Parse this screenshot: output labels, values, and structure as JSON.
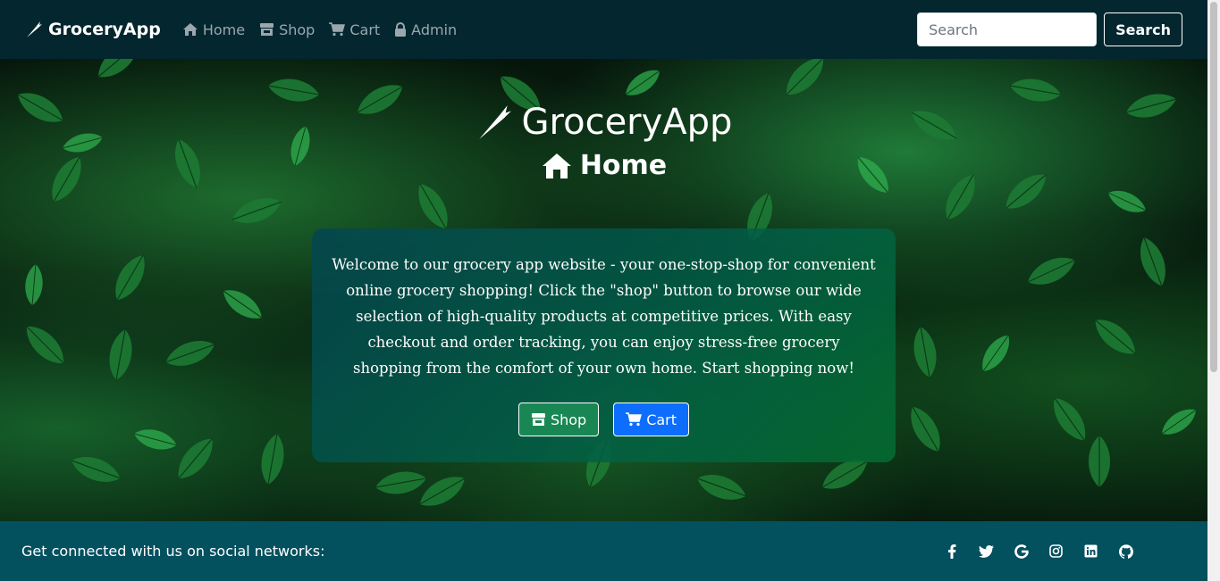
{
  "nav": {
    "brand": "GroceryApp",
    "links": [
      {
        "label": "Home",
        "icon": "home-icon"
      },
      {
        "label": "Shop",
        "icon": "store-icon"
      },
      {
        "label": "Cart",
        "icon": "cart-icon"
      },
      {
        "label": "Admin",
        "icon": "lock-icon"
      }
    ],
    "search_placeholder": "Search",
    "search_button": "Search"
  },
  "hero": {
    "title": "GroceryApp",
    "subtitle": "Home",
    "description": "Welcome to our grocery app website - your one-stop-shop for convenient online grocery shopping! Click the \"shop\" button to browse our wide selection of high-quality products at competitive prices. With easy checkout and order tracking, you can enjoy stress-free grocery shopping from the comfort of your own home. Start shopping now!",
    "shop_button": "Shop",
    "cart_button": "Cart"
  },
  "footer": {
    "text": "Get connected with us on social networks:",
    "socials": [
      "facebook-icon",
      "twitter-icon",
      "google-icon",
      "instagram-icon",
      "linkedin-icon",
      "github-icon"
    ]
  },
  "colors": {
    "navbar": "#03262f",
    "footer": "#03505f",
    "shop_button": "#198754",
    "cart_button": "#0d6efd"
  }
}
